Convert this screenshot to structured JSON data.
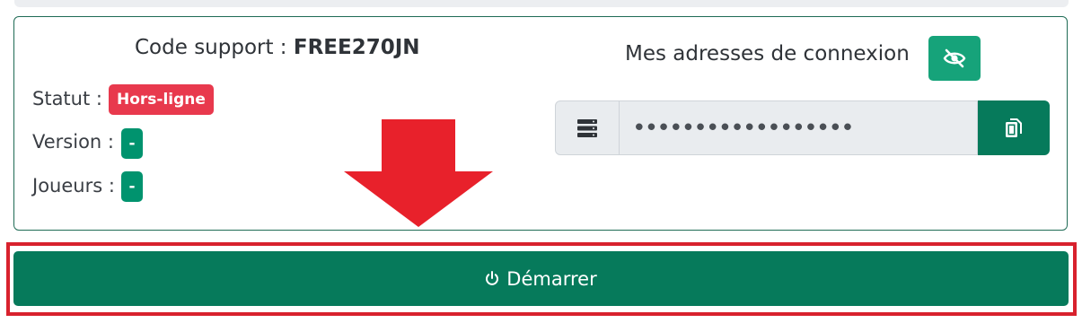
{
  "support": {
    "label": "Code support : ",
    "code": "FREE270JN"
  },
  "status": {
    "statut_label": "Statut :",
    "statut_value": "Hors-ligne",
    "version_label": "Version :",
    "version_value": "-",
    "joueurs_label": "Joueurs :",
    "joueurs_value": "-"
  },
  "connexion": {
    "title": "Mes adresses de connexion",
    "toggle_icon": "eye-slash-icon",
    "server_icon": "server-icon",
    "address_value": "••••••••••••••••••",
    "copy_icon": "copy-icon"
  },
  "actions": {
    "start_label": "Démarrer",
    "start_icon": "power-icon"
  },
  "colors": {
    "offline_badge": "#e8394d",
    "info_badge": "#00936e",
    "primary": "#067a5b",
    "accent": "#16a37a",
    "highlight": "#d8212d",
    "arrow": "#e8212b"
  }
}
